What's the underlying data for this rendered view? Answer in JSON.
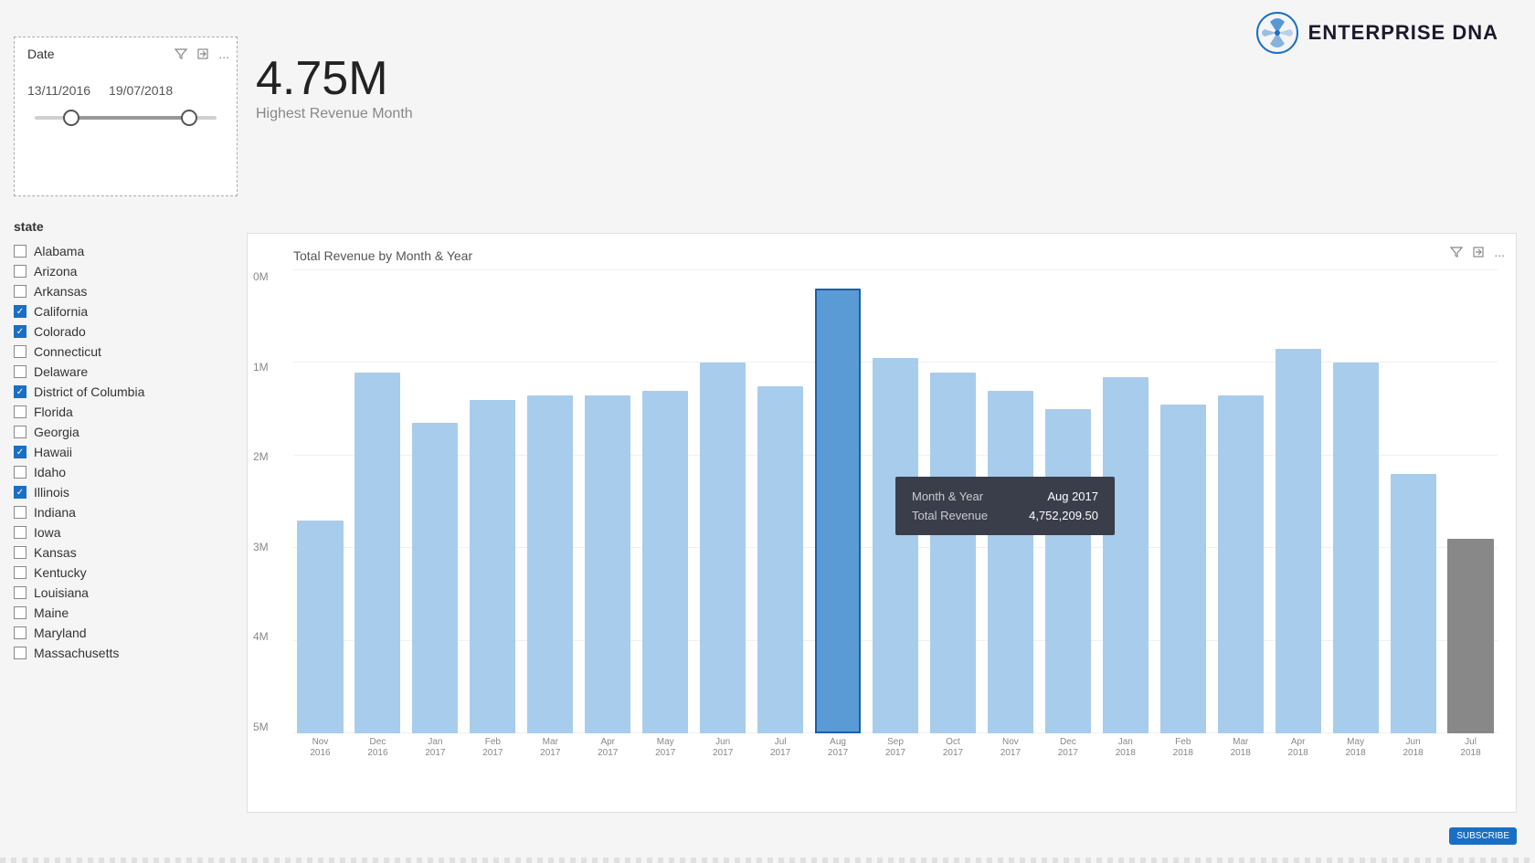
{
  "logo": {
    "text": "ENTERPRISE DNA"
  },
  "date_filter": {
    "label": "Date",
    "start": "13/11/2016",
    "end": "19/07/2018",
    "toolbar_icons": [
      "filter",
      "export",
      "more"
    ]
  },
  "kpi": {
    "value": "4.75M",
    "label": "Highest Revenue Month"
  },
  "state_list": {
    "header": "state",
    "items": [
      {
        "name": "Alabama",
        "checked": false
      },
      {
        "name": "Arizona",
        "checked": false
      },
      {
        "name": "Arkansas",
        "checked": false
      },
      {
        "name": "California",
        "checked": true
      },
      {
        "name": "Colorado",
        "checked": true
      },
      {
        "name": "Connecticut",
        "checked": false
      },
      {
        "name": "Delaware",
        "checked": false
      },
      {
        "name": "District of Columbia",
        "checked": true
      },
      {
        "name": "Florida",
        "checked": false
      },
      {
        "name": "Georgia",
        "checked": false
      },
      {
        "name": "Hawaii",
        "checked": true
      },
      {
        "name": "Idaho",
        "checked": false
      },
      {
        "name": "Illinois",
        "checked": true
      },
      {
        "name": "Indiana",
        "checked": false
      },
      {
        "name": "Iowa",
        "checked": false
      },
      {
        "name": "Kansas",
        "checked": false
      },
      {
        "name": "Kentucky",
        "checked": false
      },
      {
        "name": "Louisiana",
        "checked": false
      },
      {
        "name": "Maine",
        "checked": false
      },
      {
        "name": "Maryland",
        "checked": false
      },
      {
        "name": "Massachusetts",
        "checked": false
      }
    ]
  },
  "chart": {
    "title": "Total Revenue by Month & Year",
    "y_labels": [
      "5M",
      "4M",
      "3M",
      "2M",
      "1M",
      "0M"
    ],
    "bars": [
      {
        "label": "Nov\n2016",
        "height_pct": 46,
        "highlighted": false,
        "dark": false
      },
      {
        "label": "Dec\n2016",
        "height_pct": 78,
        "highlighted": false,
        "dark": false
      },
      {
        "label": "Jan\n2017",
        "height_pct": 67,
        "highlighted": false,
        "dark": false
      },
      {
        "label": "Feb\n2017",
        "height_pct": 72,
        "highlighted": false,
        "dark": false
      },
      {
        "label": "Mar\n2017",
        "height_pct": 73,
        "highlighted": false,
        "dark": false
      },
      {
        "label": "Apr\n2017",
        "height_pct": 73,
        "highlighted": false,
        "dark": false
      },
      {
        "label": "May\n2017",
        "height_pct": 74,
        "highlighted": false,
        "dark": false
      },
      {
        "label": "Jun\n2017",
        "height_pct": 80,
        "highlighted": false,
        "dark": false
      },
      {
        "label": "Jul\n2017",
        "height_pct": 75,
        "highlighted": false,
        "dark": false
      },
      {
        "label": "Aug\n2017",
        "height_pct": 96,
        "highlighted": true,
        "dark": false
      },
      {
        "label": "Sep\n2017",
        "height_pct": 81,
        "highlighted": false,
        "dark": false
      },
      {
        "label": "Oct\n2017",
        "height_pct": 78,
        "highlighted": false,
        "dark": false
      },
      {
        "label": "Nov\n2017",
        "height_pct": 74,
        "highlighted": false,
        "dark": false
      },
      {
        "label": "Dec\n2017",
        "height_pct": 70,
        "highlighted": false,
        "dark": false
      },
      {
        "label": "Jan\n2018",
        "height_pct": 77,
        "highlighted": false,
        "dark": false
      },
      {
        "label": "Feb\n2018",
        "height_pct": 71,
        "highlighted": false,
        "dark": false
      },
      {
        "label": "Mar\n2018",
        "height_pct": 73,
        "highlighted": false,
        "dark": false
      },
      {
        "label": "Apr\n2018",
        "height_pct": 83,
        "highlighted": false,
        "dark": false
      },
      {
        "label": "May\n2018",
        "height_pct": 80,
        "highlighted": false,
        "dark": false
      },
      {
        "label": "Jun\n2018",
        "height_pct": 56,
        "highlighted": false,
        "dark": false
      },
      {
        "label": "Jul\n2018",
        "height_pct": 42,
        "highlighted": false,
        "dark": true
      }
    ]
  },
  "tooltip": {
    "visible": true,
    "month_year_label": "Month & Year",
    "month_year_value": "Aug 2017",
    "revenue_label": "Total Revenue",
    "revenue_value": "4,752,209.50"
  },
  "subscribe": "SUBSCRIBE"
}
